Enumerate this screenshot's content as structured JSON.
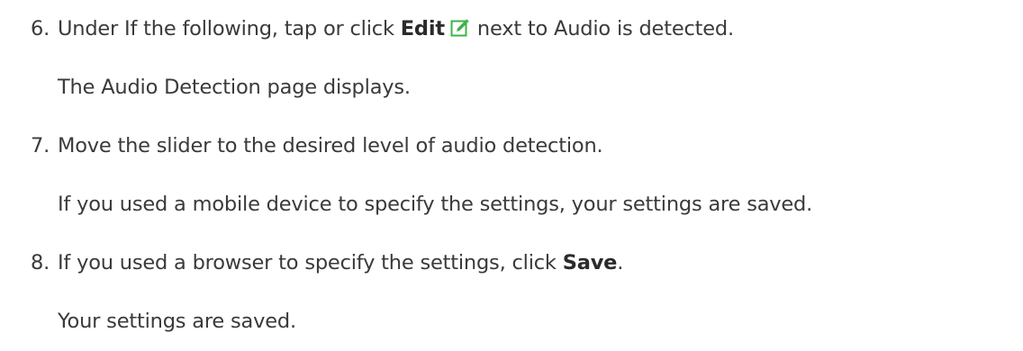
{
  "steps": [
    {
      "number": "6.",
      "text_before": "Under If the following, tap or click ",
      "bold": "Edit",
      "icon": "edit-icon",
      "text_after": "next to Audio is detected.",
      "result": "The Audio Detection page displays."
    },
    {
      "number": "7.",
      "text": "Move the slider to the desired level of audio detection.",
      "result": "If you used a mobile device to specify the settings, your settings are saved."
    },
    {
      "number": "8.",
      "text_before": "If you used a browser to specify the settings, click ",
      "bold": "Save",
      "text_after": ".",
      "result": "Your settings are saved."
    }
  ],
  "colors": {
    "text": "#3a3a3a",
    "icon_green": "#3cb44a"
  }
}
